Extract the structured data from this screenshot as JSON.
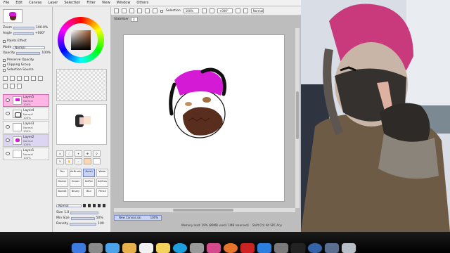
{
  "menu": [
    "File",
    "Edit",
    "Canvas",
    "Layer",
    "Selection",
    "Filter",
    "View",
    "Window",
    "Others"
  ],
  "left_panel": {
    "nav_labels": [
      "Zoom",
      "Angle"
    ],
    "zoom_value": "100.0%",
    "angle_value": "+000°",
    "paint_effect_label": "Paints Effect",
    "mode_label": "Mode",
    "mode_value": "Normal",
    "opacity_label": "Opacity",
    "opacity_value": "100%",
    "options": [
      "Preserve Opacity",
      "Clipping Group",
      "Selection Source"
    ]
  },
  "layers": [
    {
      "name": "Layer5",
      "mode": "Normal",
      "opacity": "100%",
      "selected": true
    },
    {
      "name": "Layer4",
      "mode": "Normal",
      "opacity": "100%",
      "selected": false
    },
    {
      "name": "Layer3",
      "mode": "Normal",
      "opacity": "100%",
      "selected": false
    },
    {
      "name": "Layer2",
      "mode": "Normal",
      "opacity": "100%",
      "selected": false
    },
    {
      "name": "Layer1",
      "mode": "Normal",
      "opacity": "100%",
      "selected": false
    }
  ],
  "brushes": [
    "Pen",
    "AirBrush",
    "Brush",
    "Water",
    "Marker",
    "Eraser",
    "SelPen",
    "SelEras",
    "Bucket",
    "Binary",
    "Blur",
    "Pencil"
  ],
  "brush_settings": {
    "mode_value": "Normal",
    "size_label": "Size",
    "size_value": "1.0",
    "min_size_label": "Min Size",
    "min_size_value": "50%",
    "density_label": "Density",
    "density_value": "100"
  },
  "toolbar": {
    "selection_label": "Selection",
    "zoom_value": "100%",
    "angle_value": "+000°",
    "blend_value": "Normal",
    "stabilizer_label": "Stabilizer",
    "stabilizer_value": "3"
  },
  "canvas": {
    "doc_tab": "New Canvas.sai",
    "doc_zoom": "100%",
    "status": "Memory load: 29% (89MB used / 1MB reserved)",
    "status_keys": "Shift Ctrl Alt SPC Any"
  },
  "colors": {
    "drawing_hair": "#d51ad6",
    "drawing_mask": "#5a2e1e",
    "selected_layer": "#ffb4e6"
  }
}
